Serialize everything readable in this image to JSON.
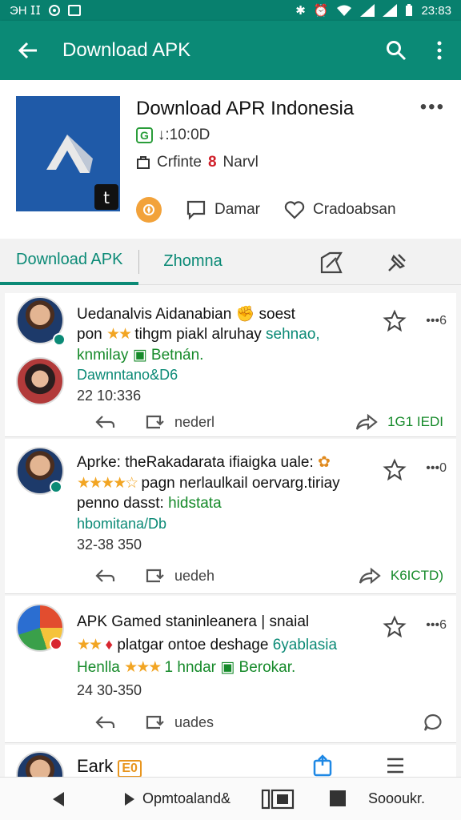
{
  "status_bar": {
    "left_text": "ЭН 𝖨𝖨",
    "time": "23:83"
  },
  "app_bar": {
    "title": "Download APK"
  },
  "header": {
    "app_name": "Download APR Indonesia",
    "version_badge": "G",
    "version_text": "↓:10:0D",
    "category_prefix": "Crfinte",
    "category_num": "8",
    "category_suffix": "Narvl",
    "action1": "Damar",
    "action2": "Cradoabsan"
  },
  "tabs": {
    "tab1": "Download APK",
    "tab2": "Zhomna"
  },
  "posts": [
    {
      "line1": "Uedanalvis Aidanabian",
      "line1b": "soest",
      "line2_prefix": "pon",
      "line2_rating": "★★",
      "line2_text": "tihgm piakl alruhay",
      "line2_green": "sehnao,",
      "line3": "knmilay",
      "line3_green": "Betnán.",
      "line4": "Dawnntano&D6",
      "time": "22 10:336",
      "action_label": "nederl",
      "count": "1G1 IEDI",
      "more": "•••6"
    },
    {
      "line1": "Aprke: theRakadarata ifiaigka uale:",
      "line2_rating": "★★★★☆",
      "line2_text": "pagn nerlaulkail oervarg.tiriay",
      "line3": "penno dasst:",
      "line3_green": "hidstata",
      "line4": "hbomitana/Db",
      "time": "32-38 350",
      "action_label": "uedeh",
      "count": "K6ICTD)",
      "more": "•••0"
    },
    {
      "line1": "APK Gamed staninleanera | snaial",
      "line2_rating": "★★",
      "line2_text": "platgar ontoe deshage",
      "line2_green": "6yablasia",
      "line3": "Henlla",
      "line3_rating": "★★★",
      "line3_text": "1 hndar",
      "line3_green": "Berokar.",
      "time": "24 30-350",
      "action_label": "uades",
      "more": "•••6"
    },
    {
      "line1": "Eark"
    }
  ],
  "bottom_bar": {
    "item1": "Opmtoaland&",
    "item2": "Soooukr."
  },
  "colors": {
    "primary": "#0b8a76",
    "status_bar": "#08806e",
    "green_text": "#168a2a",
    "star": "#f2a523"
  }
}
